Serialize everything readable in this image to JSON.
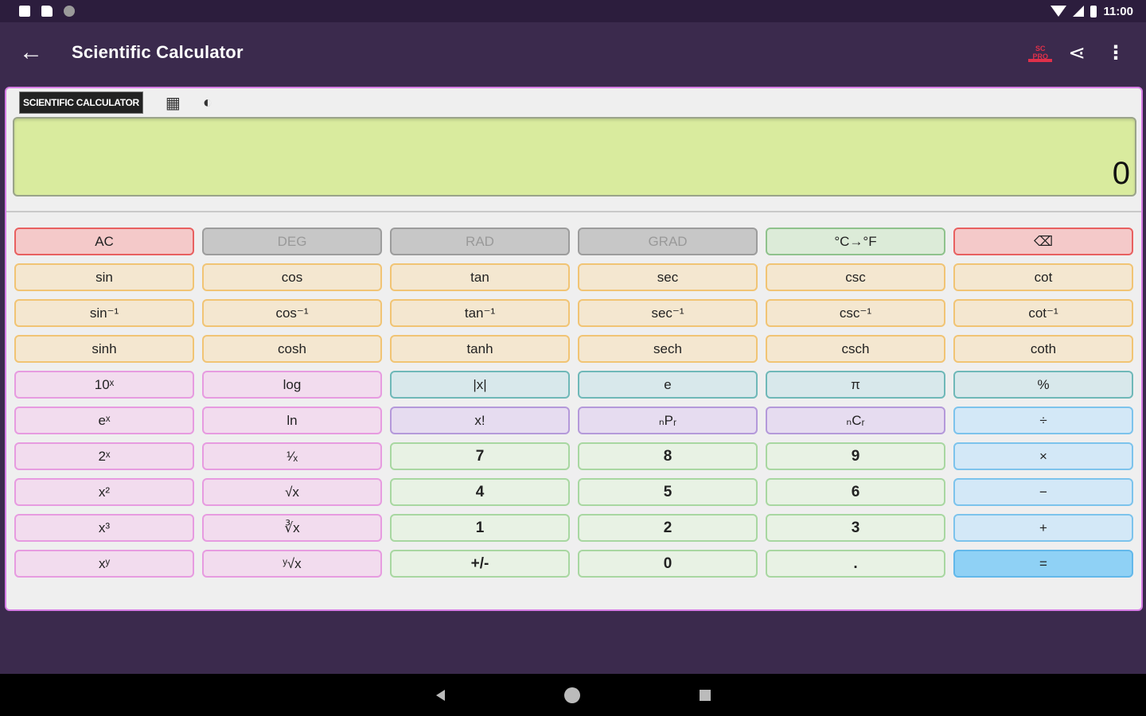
{
  "status": {
    "time": "11:00"
  },
  "app": {
    "title": "Scientific Calculator",
    "pro_badge": "SC PRO"
  },
  "tabs": {
    "active": "SCIENTIFIC CALCULATOR"
  },
  "display": {
    "value": "0"
  },
  "keys": [
    [
      "AC",
      "DEG",
      "RAD",
      "GRAD",
      "°C→°F",
      "⌫"
    ],
    [
      "sin",
      "cos",
      "tan",
      "sec",
      "csc",
      "cot"
    ],
    [
      "sin⁻¹",
      "cos⁻¹",
      "tan⁻¹",
      "sec⁻¹",
      "csc⁻¹",
      "cot⁻¹"
    ],
    [
      "sinh",
      "cosh",
      "tanh",
      "sech",
      "csch",
      "coth"
    ],
    [
      "10ˣ",
      "log",
      "|x|",
      "e",
      "π",
      "%"
    ],
    [
      "eˣ",
      "ln",
      "x!",
      "ₙPᵣ",
      "ₙCᵣ",
      "÷"
    ],
    [
      "2ˣ",
      "¹⁄ₓ",
      "7",
      "8",
      "9",
      "×"
    ],
    [
      "x²",
      "√x",
      "4",
      "5",
      "6",
      "−"
    ],
    [
      "x³",
      "∛x",
      "1",
      "2",
      "3",
      "+"
    ],
    [
      "xʸ",
      "ʸ√x",
      "+/-",
      "0",
      ".",
      "="
    ]
  ]
}
